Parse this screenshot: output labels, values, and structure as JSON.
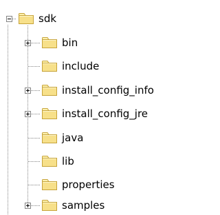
{
  "tree": {
    "root": {
      "label": "sdk",
      "icon": "folder-icon",
      "expanded": true
    },
    "children": [
      {
        "label": "bin",
        "icon": "folder-icon",
        "has_children": true,
        "expanded": false
      },
      {
        "label": "include",
        "icon": "folder-icon",
        "has_children": false
      },
      {
        "label": "install_config_info",
        "icon": "folder-icon",
        "has_children": true,
        "expanded": false
      },
      {
        "label": "install_config_jre",
        "icon": "folder-icon",
        "has_children": true,
        "expanded": false
      },
      {
        "label": "java",
        "icon": "folder-icon",
        "has_children": false
      },
      {
        "label": "lib",
        "icon": "folder-icon",
        "has_children": false
      },
      {
        "label": "properties",
        "icon": "folder-icon",
        "has_children": false
      },
      {
        "label": "samples",
        "icon": "folder-icon",
        "has_children": true,
        "expanded": false
      }
    ]
  },
  "colors": {
    "folder_fill": "#f7e08a",
    "folder_outline": "#c6a33a",
    "tree_line": "#848484"
  }
}
